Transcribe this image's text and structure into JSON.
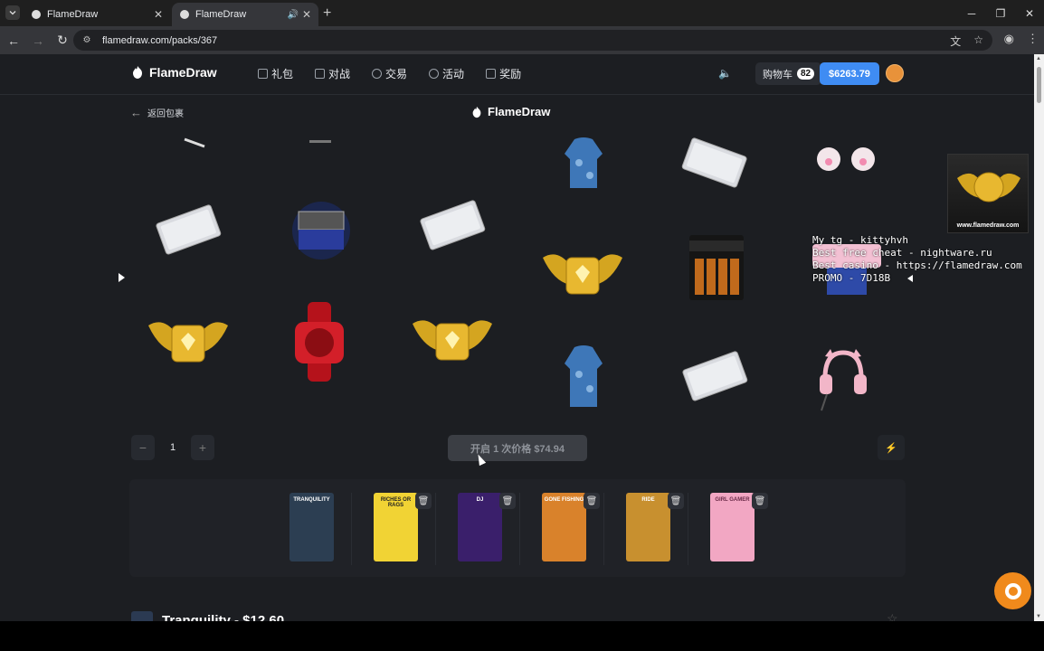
{
  "browser": {
    "tabs": [
      {
        "title": "FlameDraw",
        "active": false
      },
      {
        "title": "FlameDraw",
        "active": true
      }
    ],
    "url": "flamedraw.com/packs/367"
  },
  "site": {
    "brand": "FlameDraw",
    "menu": [
      {
        "label": "礼包",
        "icon": "gift-icon"
      },
      {
        "label": "对战",
        "icon": "swords-icon"
      },
      {
        "label": "交易",
        "icon": "trade-icon"
      },
      {
        "label": "活动",
        "icon": "event-icon"
      },
      {
        "label": "奖励",
        "icon": "reward-icon"
      }
    ],
    "cart_label": "购物车",
    "cart_count": "82",
    "balance": "$6263.79",
    "accent": "#3f8cf3"
  },
  "pack_page": {
    "back_label": "返回包裹",
    "center_brand": "FlameDraw",
    "quantity": "1",
    "open_button": "开启 1 次价格 $74.94"
  },
  "overlay": {
    "image_caption": "www.flamedraw.com",
    "text_lines": [
      "My tg - kittyhvh",
      "Best free cheat - nightware.ru",
      "Best casino - https://flamedraw.com",
      "PROMO - 7D18B"
    ]
  },
  "reels": {
    "left": [
      [
        "silver-ticket",
        "item-box",
        "silver-ticket"
      ],
      [
        "gold-wings-badge",
        "red-watch",
        "gold-wings-badge"
      ]
    ],
    "right": [
      [
        "blue-camo-hoodie",
        "silver-ticket",
        "cat-paw-grips"
      ],
      [
        "gold-wings-badge",
        "duracell-batteries",
        "pink-mystery-box"
      ],
      [
        "blue-camo-hoodie",
        "silver-ticket",
        "pink-cat-headphones"
      ]
    ]
  },
  "cart_packs": [
    {
      "name": "TRANQUILITY",
      "color": "#2c3e52",
      "deletable": false
    },
    {
      "name": "RICHES OR RAGS",
      "color": "#f1d334",
      "deletable": true
    },
    {
      "name": "DJ",
      "color": "#3a1f6b",
      "deletable": true
    },
    {
      "name": "GONE FISHING",
      "color": "#d9822b",
      "deletable": true
    },
    {
      "name": "RIDE",
      "color": "#c8902f",
      "deletable": true
    },
    {
      "name": "GIRL GAMER",
      "color": "#f2a7c3",
      "deletable": true
    }
  ],
  "bottom_heading": "Tranquility - $12.60"
}
